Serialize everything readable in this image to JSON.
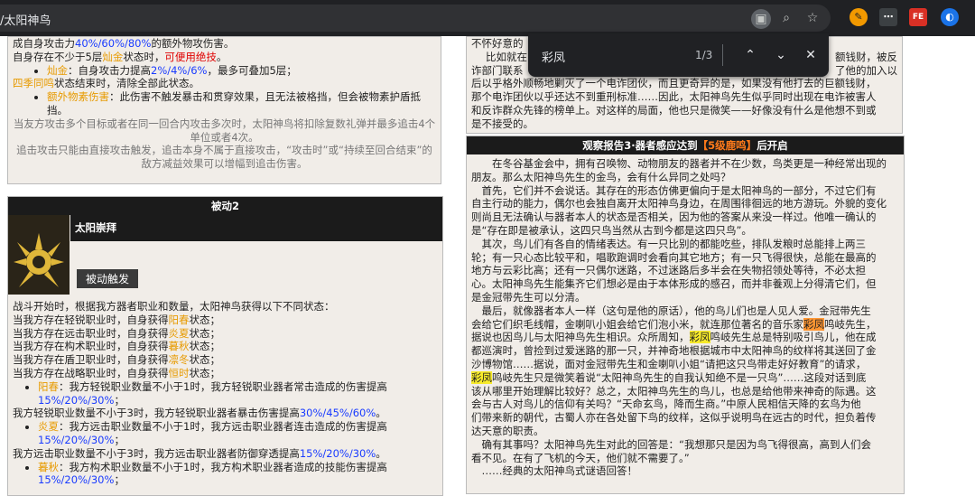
{
  "browser": {
    "url": "/太阳神鸟",
    "find": {
      "query": "彩凤",
      "count": "1/3"
    },
    "colors": {
      "accent": "#f7ea2a",
      "current_match": "#ff9632"
    }
  },
  "left": {
    "top": {
      "line1": [
        "成自身攻击力",
        "40%/60%/80%",
        "的额外物攻伤害。"
      ],
      "line2": [
        "自身存在不少于5层",
        "灿金",
        "状态时，",
        "可便用绝技",
        "。"
      ],
      "bullet1": [
        "灿金",
        "：自身攻击力提高",
        "2%/4%/6%",
        "，最多可叠加5层；"
      ],
      "line3": [
        "四季同鸣",
        "状态结束时，清除全部此状态。"
      ],
      "bullet2": [
        "额外物素伤害",
        "：此伤害不触发暴击和贯穿效果，且无法被格挡，但会被物素护盾抵挡。"
      ],
      "gray1": "当友方攻击多个目标或者在同一回合内攻击多次时，太阳神鸟将扣除复数礼弹并最多追击4个单位或者4次。",
      "gray2": "追击攻击只能由直接攻击触发，追击本身不属于直接攻击，“攻击时”或“持续至回合结束”的敌方减益效果可以增幅到追击伤害。"
    },
    "passive": {
      "header": "被动2",
      "skill_name": "太阳崇拜",
      "tag": "被动触发",
      "intro": "战斗开始时，根据我方器者职业和数量，太阳神鸟获得以下不同状态：",
      "states": [
        {
          "pre": "当我方存在轻锐职业时，自身获得",
          "name": "阳春",
          "post": "状态；"
        },
        {
          "pre": "当我方存在远击职业时，自身获得",
          "name": "炎夏",
          "post": "状态；"
        },
        {
          "pre": "当我方存在构术职业时，自身获得",
          "name": "暮秋",
          "post": "状态；"
        },
        {
          "pre": "当我方存在盾卫职业时，自身获得",
          "name": "凛冬",
          "post": "状态；"
        },
        {
          "pre": "当我方存在战略职业时，自身获得",
          "name": "恒时",
          "post": "状态；"
        }
      ],
      "b1": {
        "name": "阳春",
        "text": "：我方轻锐职业数量不小于1时，我方轻锐职业器者常击造成的伤害提高",
        "val": "15%/20%/30%",
        "end": "；"
      },
      "b1f": {
        "pre": "我方轻锐职业数量不小于3时，我方轻锐职业器者暴击伤害提高",
        "val": "30%/45%/60%",
        "end": "。"
      },
      "b2": {
        "name": "炎夏",
        "text": "：我方远击职业数量不小于1时，我方远击职业器者连击造成的伤害提高",
        "val": "15%/20%/30%",
        "end": "；"
      },
      "b2f": {
        "pre": "我方远击职业数量不小于3时，我方远击职业器者防御穿透提高",
        "val": "15%/20%/30%",
        "end": "。"
      },
      "b3": {
        "name": "暮秋",
        "text": "：我方构术职业数量不小于1时，我方构术职业器者造成的技能伤害提高",
        "val": "15%/20%/30%",
        "end": "；"
      }
    }
  },
  "right": {
    "top": {
      "line0": "不怀好意的",
      "line1a": "比如就在",
      "line1b": "额钱财，被反",
      "line2a": "诈部门联系",
      "line2b": "了他的加入以",
      "line3": "后以乎格外顺畅地剿灭了一个电诈团伙，而且更奇异的是，如果没有他打去的巨额钱财，",
      "line4": "那个电诈团伙以乎还达不到重刑标准……因此，太阳神鸟先生似乎同时出现在电诈被害人",
      "line5": "和反诈群众先锋的榜单上。对这样的局面，他也只是微笑——好像没有什么是他想不到或",
      "line6": "是不接受的。"
    },
    "header": {
      "pre": "观察报告3·器者感应达到",
      "tag": "【5级鹿鸣】",
      "post": "后开启"
    },
    "body": [
      "在冬谷基金会中，拥有召唤物、动物朋友的器者并不在少数，鸟类更是一种经常出现的",
      "朋友。那么太阳神鸟先生的金鸟，会有什么异同之处吗？",
      "首先，它们并不会说话。其存在的形态仿佛更偏向于是太阳神鸟的一部分，不过它们有",
      "自主行动的能力，偶尔也会独自离开太阳神鸟身边，在周围徘徊远的地方游玩。外貌的变化",
      "则尚且无法确认与器者本人的状态是否相关，因为他的答案从来没一样过。他唯一确认的",
      "是“存在即是被承认，这四只鸟当然从古到今都是这四只鸟”。",
      "其次，鸟儿们有各自的情绪表达。有一只比别的都能吃些，排队发粮时总能排上两三",
      "轮；有一只心态比较平和，唱歌跑调时会看向其它地方；有一只飞得很快，总能在最高的",
      "地方与云彩比高；还有一只偶尔迷路，不过迷路后多半会在失物招领处等待，不必太担",
      "心。太阳神鸟先生能集齐它们想必是由于本体形成的感召，而并非養观上分得清它们，但",
      "是金冠带先生可以分清。",
      "最后，就像器者本人一样（这句是他的原话），他的鸟儿们也是人见人爱。金冠带先生"
    ],
    "hl1": [
      "会给它们织毛线帽，金喇叭小姐会给它们泡小米，就连那位著名的音乐家",
      "彩凤",
      "鸣岐先生，"
    ],
    "hl2": [
      "据说也因鸟儿与太阳神鸟先生相识。众所周知，",
      "彩凤",
      "鸣岐先生总是特别吸引鸟儿，他在成"
    ],
    "body2": [
      "都巡演时，曾捡到过爱迷路的那一只，并神奇地根据城市中太阳神鸟的纹样将其送回了金",
      "沙博物馆……据说，面对金冠带先生和金喇叭小姐“请把这只鸟带走好好教育”的请求，"
    ],
    "hl3": [
      "彩凤",
      "鸣岐先生只是微笑着说“太阳神鸟先生的自我认知绝不是一只鸟”……这段对话到底"
    ],
    "body3": [
      "该从哪里开始理解比较好？总之，太阳神鸟先生的鸟儿，也总是给他带来神奇的际遇。这",
      "会与古人对鸟儿的信仰有关吗？“天命玄鸟，降而生商。”中原人民相信天降的玄鸟为他",
      "们带来新的朝代，古蜀人亦在各处留下鸟的纹样，这似乎说明鸟在远古的时代，担负着传",
      "达天意的职责。",
      "确有其事吗？太阳神鸟先生对此的回答是：“我想那只是因为鸟飞得很高，高到人们会",
      "看不见。在有了飞机的今天，他们就不需要了。”",
      "……经典的太阳神鸟式谜语回答！"
    ]
  }
}
